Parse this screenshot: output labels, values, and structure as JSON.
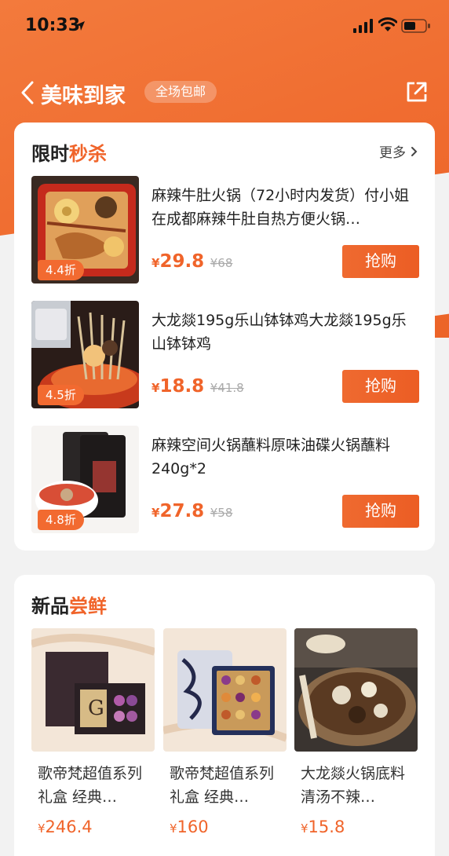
{
  "status": {
    "time": "10:33"
  },
  "nav": {
    "title": "美味到家",
    "badge": "全场包邮"
  },
  "colors": {
    "accent": "#f0642a",
    "header": "#ef6a2e"
  },
  "flash": {
    "title_main": "限时",
    "title_accent": "秒杀",
    "more": "更多",
    "items": [
      {
        "title": "麻辣牛肚火锅（72小时内发货）付小姐在成都麻辣牛肚自热方便火锅…",
        "discount": "4.4折",
        "yen": "¥",
        "price": "29.8",
        "orig": "¥68",
        "btn": "抢购"
      },
      {
        "title": "大龙燚195g乐山钵钵鸡大龙燚195g乐山钵钵鸡",
        "discount": "4.5折",
        "yen": "¥",
        "price": "18.8",
        "orig": "¥41.8",
        "btn": "抢购"
      },
      {
        "title": "麻辣空间火锅蘸料原味油碟火锅蘸料240g*2",
        "discount": "4.8折",
        "yen": "¥",
        "price": "27.8",
        "orig": "¥58",
        "btn": "抢购"
      }
    ]
  },
  "newitems": {
    "title_main": "新品",
    "title_accent": "尝鲜",
    "items": [
      {
        "title": "歌帝梵超值系列礼盒 经典…",
        "yen": "¥",
        "price": "246.4"
      },
      {
        "title": "歌帝梵超值系列礼盒 经典…",
        "yen": "¥",
        "price": "160"
      },
      {
        "title": "大龙燚火锅底料清汤不辣…",
        "yen": "¥",
        "price": "15.8"
      }
    ]
  }
}
